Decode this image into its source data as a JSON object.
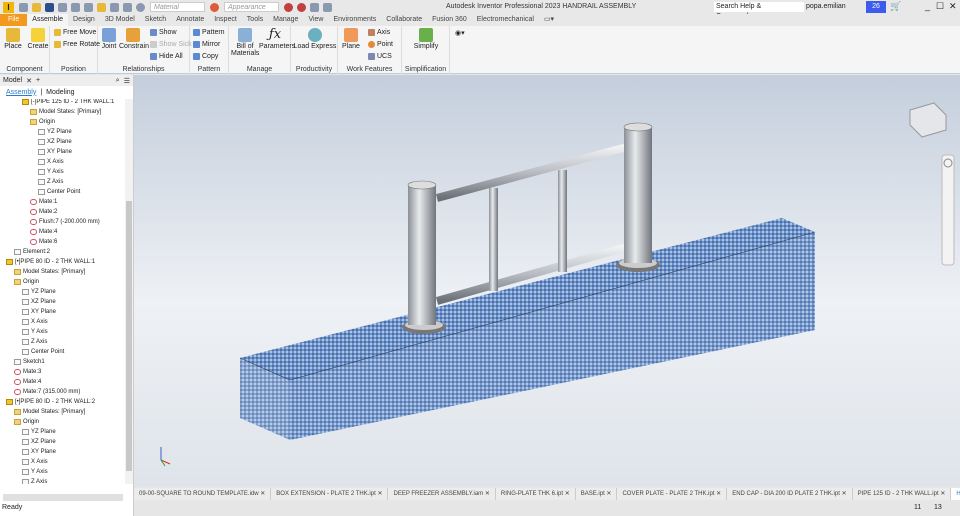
{
  "titlebar": {
    "logo": "I",
    "material": "Material",
    "appearance": "Appearance",
    "title": "Autodesk Inventor Professional 2023    HANDRAIL ASSEMBLY",
    "search_placeholder": "Search Help & Commands...",
    "user": "popa.emilian",
    "clock_count": "26"
  },
  "tabs": [
    "File",
    "Assemble",
    "Design",
    "3D Model",
    "Sketch",
    "Annotate",
    "Inspect",
    "Tools",
    "Manage",
    "View",
    "Environments",
    "Collaborate",
    "Fusion 360",
    "Electromechanical"
  ],
  "ribbon": {
    "component": {
      "label": "Component",
      "place": "Place",
      "create": "Create"
    },
    "position": {
      "label": "Position",
      "free_move": "Free Move",
      "free_rotate": "Free Rotate"
    },
    "relationships": {
      "label": "Relationships",
      "joint": "Joint",
      "constrain": "Constrain",
      "show": "Show",
      "show_sick": "Show Sick",
      "hide_all": "Hide All"
    },
    "pattern": {
      "label": "Pattern",
      "pattern": "Pattern",
      "mirror": "Mirror",
      "copy": "Copy"
    },
    "manage": {
      "label": "Manage",
      "bom": "Bill of Materials",
      "parameters": "Parameters"
    },
    "productivity": {
      "label": "Productivity",
      "load_express": "Load Express"
    },
    "work_features": {
      "label": "Work Features",
      "plane": "Plane",
      "axis": "Axis",
      "point": "Point",
      "ucs": "UCS"
    },
    "simplification": {
      "label": "Simplification",
      "simplify": "Simplify"
    }
  },
  "panel": {
    "tab": "Model",
    "subtab_assembly": "Assembly",
    "subtab_modeling": "Modeling",
    "status": "Ready",
    "tree": [
      {
        "t": "[-]PIPE 125 ID - 2 THK WALL:1",
        "d": 2,
        "i": "p"
      },
      {
        "t": "Model States: [Primary]",
        "d": 3,
        "i": "f"
      },
      {
        "t": "Origin",
        "d": 3,
        "i": "f"
      },
      {
        "t": "YZ Plane",
        "d": 4,
        "i": "n"
      },
      {
        "t": "XZ Plane",
        "d": 4,
        "i": "n"
      },
      {
        "t": "XY Plane",
        "d": 4,
        "i": "n"
      },
      {
        "t": "X Axis",
        "d": 4,
        "i": "n"
      },
      {
        "t": "Y Axis",
        "d": 4,
        "i": "n"
      },
      {
        "t": "Z Axis",
        "d": 4,
        "i": "n"
      },
      {
        "t": "Center Point",
        "d": 4,
        "i": "n"
      },
      {
        "t": "Mate:1",
        "d": 3,
        "i": "m"
      },
      {
        "t": "Mate:2",
        "d": 3,
        "i": "m"
      },
      {
        "t": "Flush:7 (-200.000 mm)",
        "d": 3,
        "i": "m"
      },
      {
        "t": "Mate:4",
        "d": 3,
        "i": "m"
      },
      {
        "t": "Mate:6",
        "d": 3,
        "i": "m"
      },
      {
        "t": "Element:2",
        "d": 1,
        "i": "n"
      },
      {
        "t": "[•]PIPE 80 ID - 2 THK WALL:1",
        "d": 0,
        "i": "p"
      },
      {
        "t": "Model States: [Primary]",
        "d": 1,
        "i": "f"
      },
      {
        "t": "Origin",
        "d": 1,
        "i": "f"
      },
      {
        "t": "YZ Plane",
        "d": 2,
        "i": "n"
      },
      {
        "t": "XZ Plane",
        "d": 2,
        "i": "n"
      },
      {
        "t": "XY Plane",
        "d": 2,
        "i": "n"
      },
      {
        "t": "X Axis",
        "d": 2,
        "i": "n"
      },
      {
        "t": "Y Axis",
        "d": 2,
        "i": "n"
      },
      {
        "t": "Z Axis",
        "d": 2,
        "i": "n"
      },
      {
        "t": "Center Point",
        "d": 2,
        "i": "n"
      },
      {
        "t": "Sketch1",
        "d": 1,
        "i": "n"
      },
      {
        "t": "Mate:3",
        "d": 1,
        "i": "m"
      },
      {
        "t": "Mate:4",
        "d": 1,
        "i": "m"
      },
      {
        "t": "Mate:7 (315.000 mm)",
        "d": 1,
        "i": "m"
      },
      {
        "t": "[•]PIPE 80 ID - 2 THK WALL:2",
        "d": 0,
        "i": "p"
      },
      {
        "t": "Model States: [Primary]",
        "d": 1,
        "i": "f"
      },
      {
        "t": "Origin",
        "d": 1,
        "i": "f"
      },
      {
        "t": "YZ Plane",
        "d": 2,
        "i": "n"
      },
      {
        "t": "XZ Plane",
        "d": 2,
        "i": "n"
      },
      {
        "t": "XY Plane",
        "d": 2,
        "i": "n"
      },
      {
        "t": "X Axis",
        "d": 2,
        "i": "n"
      },
      {
        "t": "Y Axis",
        "d": 2,
        "i": "n"
      },
      {
        "t": "Z Axis",
        "d": 2,
        "i": "n"
      }
    ]
  },
  "doc_tabs": [
    "09-00-SQUARE TO ROUND TEMPLATE.idw",
    "BOX EXTENSION - PLATE 2 THK.ipt",
    "DEEP FREEZER ASSEMBLY.iam",
    "RING-PLATE THK 6.ipt",
    "BASE.ipt",
    "COVER PLATE - PLATE 2 THK.ipt",
    "END CAP - DIA 200 ID PLATE 2 THK.ipt",
    "PIPE 125 ID - 2 THK WALL.ipt",
    "HANDRAIL"
  ],
  "statusbar": {
    "a": "11",
    "b": "13"
  },
  "colors": {
    "file_tab": "#f39a1e",
    "accent": "#2a7ad0",
    "clock": "#3c5cf0"
  }
}
